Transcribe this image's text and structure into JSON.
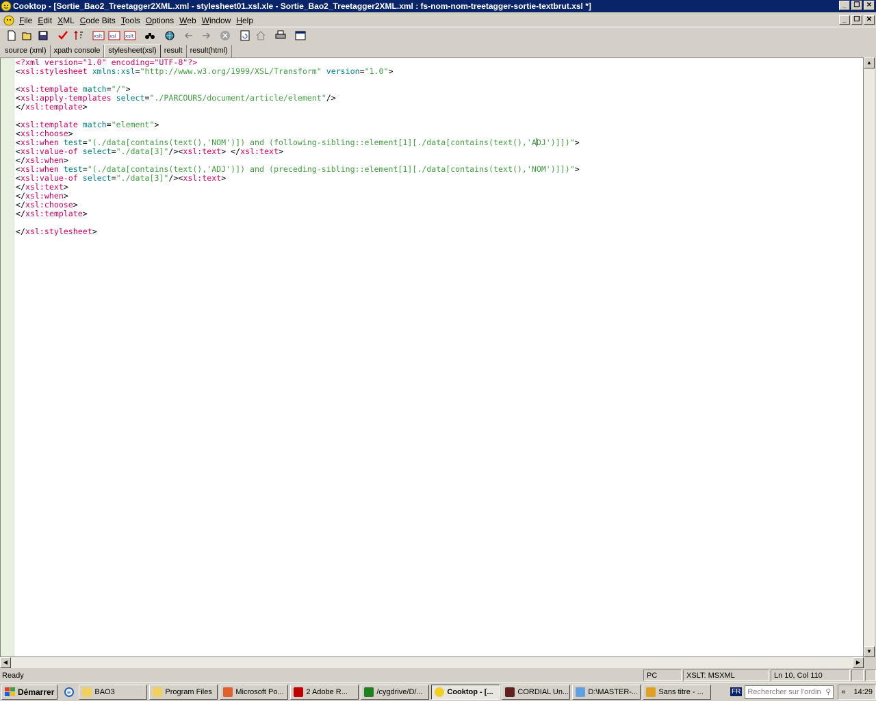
{
  "window": {
    "title": "Cooktop - [Sortie_Bao2_Treetagger2XML.xml - stylesheet01.xsl.xle - Sortie_Bao2_Treetagger2XML.xml : fs-nom-nom-treetagger-sortie-textbrut.xsl *]",
    "minimize": "_",
    "restore": "❐",
    "close": "✕"
  },
  "menu": {
    "items": [
      {
        "u": "F",
        "rest": "ile"
      },
      {
        "u": "E",
        "rest": "dit"
      },
      {
        "u": "X",
        "rest": "ML"
      },
      {
        "u": "C",
        "rest": "ode Bits"
      },
      {
        "u": "T",
        "rest": "ools"
      },
      {
        "u": "O",
        "rest": "ptions"
      },
      {
        "u": "W",
        "rest": "eb"
      },
      {
        "u": "W",
        "rest": "indow"
      },
      {
        "u": "H",
        "rest": "elp"
      }
    ]
  },
  "tabs": [
    "source (xml)",
    "xpath console",
    "stylesheet(xsl)",
    "result",
    "result(html)"
  ],
  "active_tab": 2,
  "code_lines": [
    [
      [
        "pink",
        "<?xml version=\"1.0\" encoding=\"UTF-8\"?>"
      ]
    ],
    [
      [
        "blk",
        "<"
      ],
      [
        "pink",
        "xsl:stylesheet"
      ],
      [
        "teal",
        " xmlns:xsl"
      ],
      [
        "blk",
        "="
      ],
      [
        "green",
        "\"http://www.w3.org/1999/XSL/Transform\""
      ],
      [
        "teal",
        " version"
      ],
      [
        "blk",
        "="
      ],
      [
        "green",
        "\"1.0\""
      ],
      [
        "blk",
        ">"
      ]
    ],
    [
      [
        "blk",
        ""
      ]
    ],
    [
      [
        "blk",
        "<"
      ],
      [
        "pink",
        "xsl:template"
      ],
      [
        "teal",
        " match"
      ],
      [
        "blk",
        "="
      ],
      [
        "green",
        "\"/\""
      ],
      [
        "blk",
        ">"
      ]
    ],
    [
      [
        "blk",
        "<"
      ],
      [
        "pink",
        "xsl:apply-templates"
      ],
      [
        "teal",
        " select"
      ],
      [
        "blk",
        "="
      ],
      [
        "green",
        "\"./PARCOURS/document/article/element\""
      ],
      [
        "blk",
        "/>"
      ]
    ],
    [
      [
        "blk",
        "</"
      ],
      [
        "pink",
        "xsl:template"
      ],
      [
        "blk",
        ">"
      ]
    ],
    [
      [
        "blk",
        ""
      ]
    ],
    [
      [
        "blk",
        "<"
      ],
      [
        "pink",
        "xsl:template"
      ],
      [
        "teal",
        " match"
      ],
      [
        "blk",
        "="
      ],
      [
        "green",
        "\"element\""
      ],
      [
        "blk",
        ">"
      ]
    ],
    [
      [
        "blk",
        "<"
      ],
      [
        "pink",
        "xsl:choose"
      ],
      [
        "blk",
        ">"
      ]
    ],
    [
      [
        "blk",
        "<"
      ],
      [
        "pink",
        "xsl:when"
      ],
      [
        "teal",
        " test"
      ],
      [
        "blk",
        "="
      ],
      [
        "green",
        "\"(./data[contains(text(),'NOM')]) and (following-sibling::element[1][./data[contains(text(),'A"
      ],
      [
        "caret",
        ""
      ],
      [
        "green",
        "DJ')]])\""
      ],
      [
        "blk",
        ">"
      ]
    ],
    [
      [
        "blk",
        "<"
      ],
      [
        "pink",
        "xsl:value-of"
      ],
      [
        "teal",
        " select"
      ],
      [
        "blk",
        "="
      ],
      [
        "green",
        "\"./data[3]\""
      ],
      [
        "blk",
        "/><"
      ],
      [
        "pink",
        "xsl:text"
      ],
      [
        "blk",
        "> </"
      ],
      [
        "pink",
        "xsl:text"
      ],
      [
        "blk",
        ">"
      ]
    ],
    [
      [
        "blk",
        "</"
      ],
      [
        "pink",
        "xsl:when"
      ],
      [
        "blk",
        ">"
      ]
    ],
    [
      [
        "blk",
        "<"
      ],
      [
        "pink",
        "xsl:when"
      ],
      [
        "teal",
        " test"
      ],
      [
        "blk",
        "="
      ],
      [
        "green",
        "\"(./data[contains(text(),'ADJ')]) and (preceding-sibling::element[1][./data[contains(text(),'NOM')]])\""
      ],
      [
        "blk",
        ">"
      ]
    ],
    [
      [
        "blk",
        "<"
      ],
      [
        "pink",
        "xsl:value-of"
      ],
      [
        "teal",
        " select"
      ],
      [
        "blk",
        "="
      ],
      [
        "green",
        "\"./data[3]\""
      ],
      [
        "blk",
        "/><"
      ],
      [
        "pink",
        "xsl:text"
      ],
      [
        "blk",
        ">"
      ]
    ],
    [
      [
        "blk",
        "</"
      ],
      [
        "pink",
        "xsl:text"
      ],
      [
        "blk",
        ">"
      ]
    ],
    [
      [
        "blk",
        "</"
      ],
      [
        "pink",
        "xsl:when"
      ],
      [
        "blk",
        ">"
      ]
    ],
    [
      [
        "blk",
        "</"
      ],
      [
        "pink",
        "xsl:choose"
      ],
      [
        "blk",
        ">"
      ]
    ],
    [
      [
        "blk",
        "</"
      ],
      [
        "pink",
        "xsl:template"
      ],
      [
        "blk",
        ">"
      ]
    ],
    [
      [
        "blk",
        ""
      ]
    ],
    [
      [
        "blk",
        "</"
      ],
      [
        "pink",
        "xsl:stylesheet"
      ],
      [
        "blk",
        ">"
      ]
    ]
  ],
  "status": {
    "ready": "Ready",
    "mode": "PC",
    "engine": "XSLT: MSXML",
    "position": "Ln 10, Col 110"
  },
  "taskbar": {
    "start": "Démarrer",
    "tasks": [
      {
        "label": "BAO3",
        "icon": "folder-icon"
      },
      {
        "label": "Program Files",
        "icon": "folder-icon"
      },
      {
        "label": "Microsoft Po...",
        "icon": "powerpoint-icon"
      },
      {
        "label": "2 Adobe R...",
        "icon": "adobe-icon"
      },
      {
        "label": "/cygdrive/D/...",
        "icon": "cygwin-icon"
      },
      {
        "label": "Cooktop - [...",
        "icon": "cooktop-icon",
        "active": true
      },
      {
        "label": "CORDIAL Un...",
        "icon": "cordial-icon"
      },
      {
        "label": "D:\\MASTER-...",
        "icon": "notepad-icon"
      },
      {
        "label": "Sans titre - ...",
        "icon": "paint-icon"
      }
    ],
    "lang": "FR",
    "search_placeholder": "Rechercher sur l'ordin",
    "expand": "«",
    "time": "14:29"
  },
  "colors": {
    "titlebar": "#0a246a",
    "tag": "#d00060",
    "attr": "#008080",
    "value": "#40a040"
  }
}
